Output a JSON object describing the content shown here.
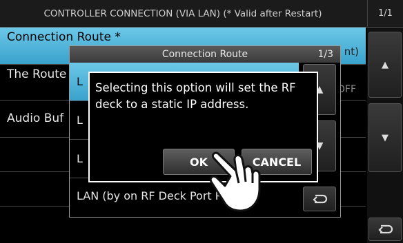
{
  "header": {
    "title": "CONTROLLER CONNECTION (VIA LAN) (* Valid after Restart)",
    "page": "1/1"
  },
  "menu": {
    "rows": [
      {
        "label": "Connection Route *",
        "value": "nt)"
      },
      {
        "label": "The Route",
        "value": "OFF"
      },
      {
        "label": "Audio Buf",
        "value": ""
      }
    ]
  },
  "submenu": {
    "title": "Connection Route",
    "page": "1/3",
    "items": [
      {
        "label": "L"
      },
      {
        "label": "L"
      },
      {
        "label": "L"
      },
      {
        "label": "LAN (by on RF Deck Port Pwr)"
      }
    ]
  },
  "dialog": {
    "message": "Selecting this option will set the RF deck to a static IP address.",
    "ok_label": "OK",
    "cancel_label": "CANCEL"
  },
  "icons": {
    "scroll_up": "triangle-up-icon",
    "scroll_down": "triangle-down-icon",
    "back": "return-arrow-icon",
    "hand": "pointing-hand-icon"
  },
  "colors": {
    "selected_row": "#4fb6dc",
    "background": "#000000"
  }
}
